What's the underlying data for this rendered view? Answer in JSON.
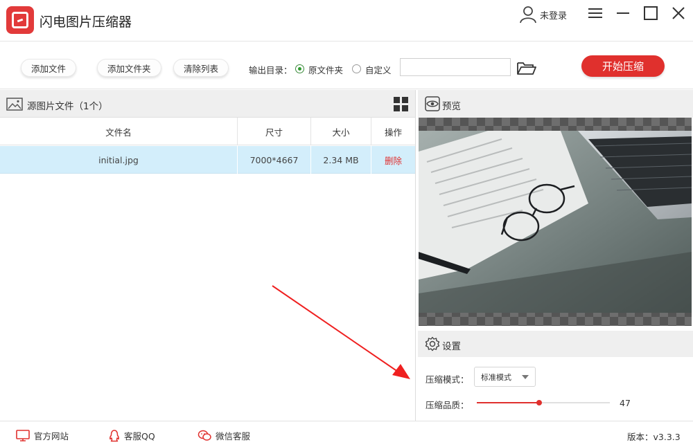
{
  "app": {
    "title": "闪电图片压缩器",
    "user": "未登录"
  },
  "toolbar": {
    "add_file": "添加文件",
    "add_folder": "添加文件夹",
    "clear_list": "清除列表",
    "output_label": "输出目录：",
    "option_original": "原文件夹",
    "option_custom": "自定义",
    "output_path": "",
    "start": "开始压缩"
  },
  "files": {
    "title": "源图片文件（1个）",
    "columns": {
      "name": "文件名",
      "size": "尺寸",
      "filesize": "大小",
      "action": "操作"
    },
    "rows": [
      {
        "name": "initial.jpg",
        "size": "7000*4667",
        "filesize": "2.34 MB",
        "action": "删除"
      }
    ]
  },
  "preview": {
    "title": "预览"
  },
  "settings": {
    "title": "设置",
    "mode_label": "压缩模式：",
    "mode_value": "标准模式",
    "quality_label": "压缩品质：",
    "quality_value": "47",
    "quality_percent": 47
  },
  "footer": {
    "website": "官方网站",
    "qq": "客服QQ",
    "wechat": "微信客服",
    "version": "版本：v3.3.3"
  },
  "colors": {
    "accent": "#e0302d",
    "selected_row": "#d3eefb"
  },
  "icons": [
    "logo-icon",
    "user-icon",
    "menu-icon",
    "minimize-icon",
    "maximize-icon",
    "close-icon",
    "folder-open-icon",
    "image-icon",
    "grid-view-icon",
    "eye-icon",
    "gear-icon",
    "monitor-icon",
    "qq-icon",
    "wechat-icon"
  ]
}
